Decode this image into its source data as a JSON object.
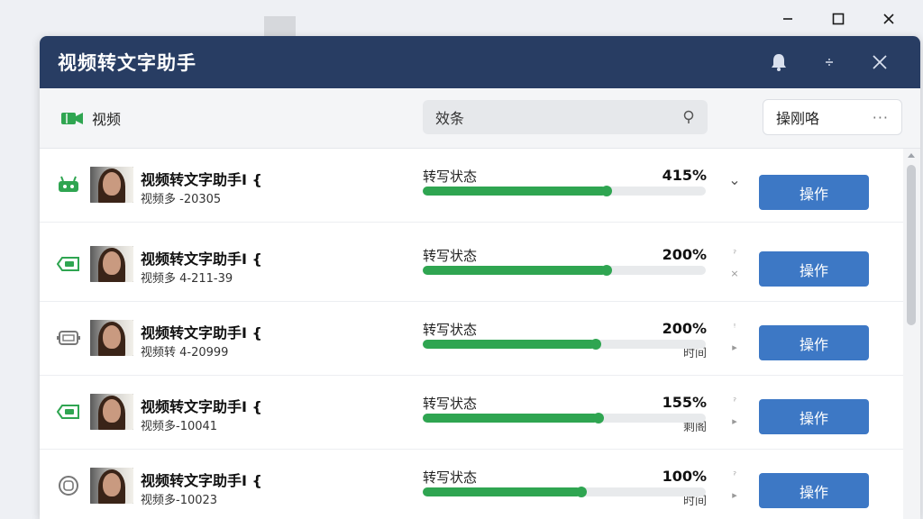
{
  "app": {
    "title": "视频转文字助手"
  },
  "toolbar": {
    "video_label": "视频",
    "search_value": "效条",
    "search_icon": "search-icon",
    "action_label": "操刚咯",
    "more_label": "···"
  },
  "colors": {
    "titlebar": "#283d63",
    "progress": "#2fa551",
    "button": "#3d78c5"
  },
  "rows": [
    {
      "icon": "robot-icon",
      "title": "视频转文字助手I {",
      "subtitle": "视频多 -20305",
      "status_label": "转写状态",
      "percent": "415%",
      "meta": "",
      "progress": 0.65,
      "side_top": "⌄",
      "side_bottom": "",
      "button": "操作"
    },
    {
      "icon": "tag-icon",
      "title": "视频转文字助手I {",
      "subtitle": "视频多 4-211-39",
      "status_label": "转写状态",
      "percent": "200%",
      "meta": "",
      "progress": 0.65,
      "side_top": "ˀ",
      "side_bottom": "×",
      "button": "操作"
    },
    {
      "icon": "monitor-icon",
      "title": "视频转文字助手I {",
      "subtitle": "视频转 4-20999",
      "status_label": "转写状态",
      "percent": "200%",
      "meta": "时间",
      "progress": 0.61,
      "side_top": "ꜝ",
      "side_bottom": "▸",
      "button": "操作"
    },
    {
      "icon": "tag-icon",
      "title": "视频转文字助手I {",
      "subtitle": "视频多-10041",
      "status_label": "转写状态",
      "percent": "155%",
      "meta": "剩阁",
      "progress": 0.62,
      "side_top": "ˀ",
      "side_bottom": "▸",
      "button": "操作"
    },
    {
      "icon": "circle-icon",
      "title": "视频转文字助手I {",
      "subtitle": "视频多-10023",
      "status_label": "转写状态",
      "percent": "100%",
      "meta": "时间",
      "progress": 0.56,
      "side_top": "ˀ",
      "side_bottom": "▸",
      "button": "操作"
    }
  ]
}
